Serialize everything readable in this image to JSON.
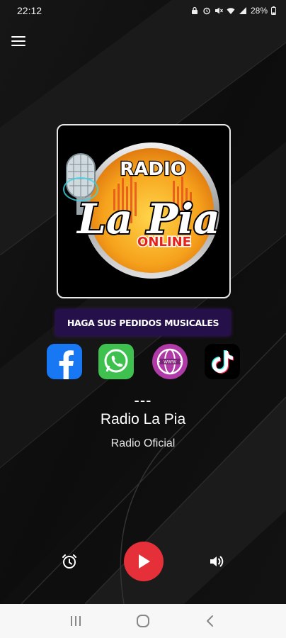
{
  "status_bar": {
    "time": "22:12",
    "battery": "28%",
    "icons": [
      "lock-icon",
      "alarm-icon",
      "mute-icon",
      "wifi-icon",
      "signal-icon",
      "battery-icon"
    ]
  },
  "header": {
    "menu_icon": "hamburger-menu-icon"
  },
  "logo": {
    "line1": "RADIO",
    "line2": "La Pia",
    "line3": "ONLINE"
  },
  "banner": {
    "label": "HAGA SUS PEDIDOS MUSICALES"
  },
  "social": [
    {
      "name": "facebook",
      "icon": "facebook-icon",
      "color": "#1877f2"
    },
    {
      "name": "whatsapp",
      "icon": "whatsapp-icon",
      "color": "#25d366"
    },
    {
      "name": "website",
      "icon": "globe-icon",
      "color": "#b03aa8"
    },
    {
      "name": "tiktok",
      "icon": "tiktok-icon",
      "color": "#000000"
    }
  ],
  "now_playing": {
    "track": "---",
    "station": "Radio La Pia",
    "subtitle": "Radio Oficial"
  },
  "controls": {
    "alarm_icon": "alarm-clock-icon",
    "play_icon": "play-icon",
    "volume_icon": "volume-icon",
    "accent": "#e5303a"
  },
  "nav_bar": {
    "icons": [
      "recent-apps-icon",
      "home-icon",
      "back-icon"
    ]
  }
}
